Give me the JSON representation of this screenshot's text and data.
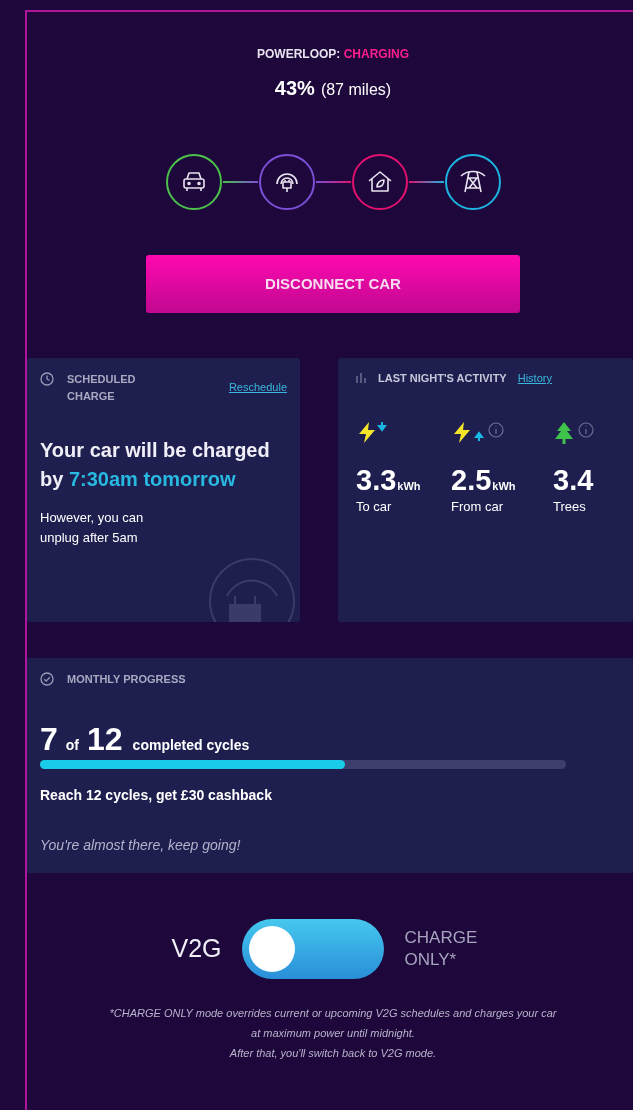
{
  "status": {
    "label": "POWERLOOP:",
    "state": "CHARGING"
  },
  "battery": {
    "percent": "43%",
    "range": "(87 miles)"
  },
  "flow": [
    {
      "kind": "car",
      "color": "#4cc24a"
    },
    {
      "kind": "charger",
      "color": "#7b4fd6"
    },
    {
      "kind": "home",
      "color": "#e0126e"
    },
    {
      "kind": "grid",
      "color": "#1cb5e0"
    }
  ],
  "primary_button": "DISCONNECT CAR",
  "scheduled": {
    "title": "SCHEDULED CHARGE",
    "link": "Reschedule",
    "message": "Your car will be charged by",
    "time": "7:30am tomorrow",
    "note": "However, you can unplug after 5am"
  },
  "activity": {
    "title": "LAST NIGHT'S ACTIVITY",
    "link": "History",
    "stats": [
      {
        "kind": "to_car",
        "info": false,
        "value": "3.3",
        "unit": "kWh",
        "label": "To car"
      },
      {
        "kind": "from_car",
        "info": true,
        "value": "2.5",
        "unit": "kWh",
        "label": "From car"
      },
      {
        "kind": "trees",
        "info": true,
        "value": "3.4",
        "label": "Trees"
      }
    ]
  },
  "monthly": {
    "title": "MONTHLY PROGRESS",
    "done": "7",
    "of": "of",
    "total": "12",
    "caption": "completed cycles",
    "level": 0.58,
    "reward": "Reach 12 cycles, get £30 cashback",
    "encouragement": "You're almost there, keep going!"
  },
  "mode": {
    "left": "V2G",
    "right": "CHARGE ONLY*",
    "charge_only": false
  },
  "footnote": [
    "*CHARGE ONLY mode overrides current or upcoming V2G schedules and charges your car at maximum power until midnight.",
    "After that, you'll switch back to V2G mode."
  ]
}
